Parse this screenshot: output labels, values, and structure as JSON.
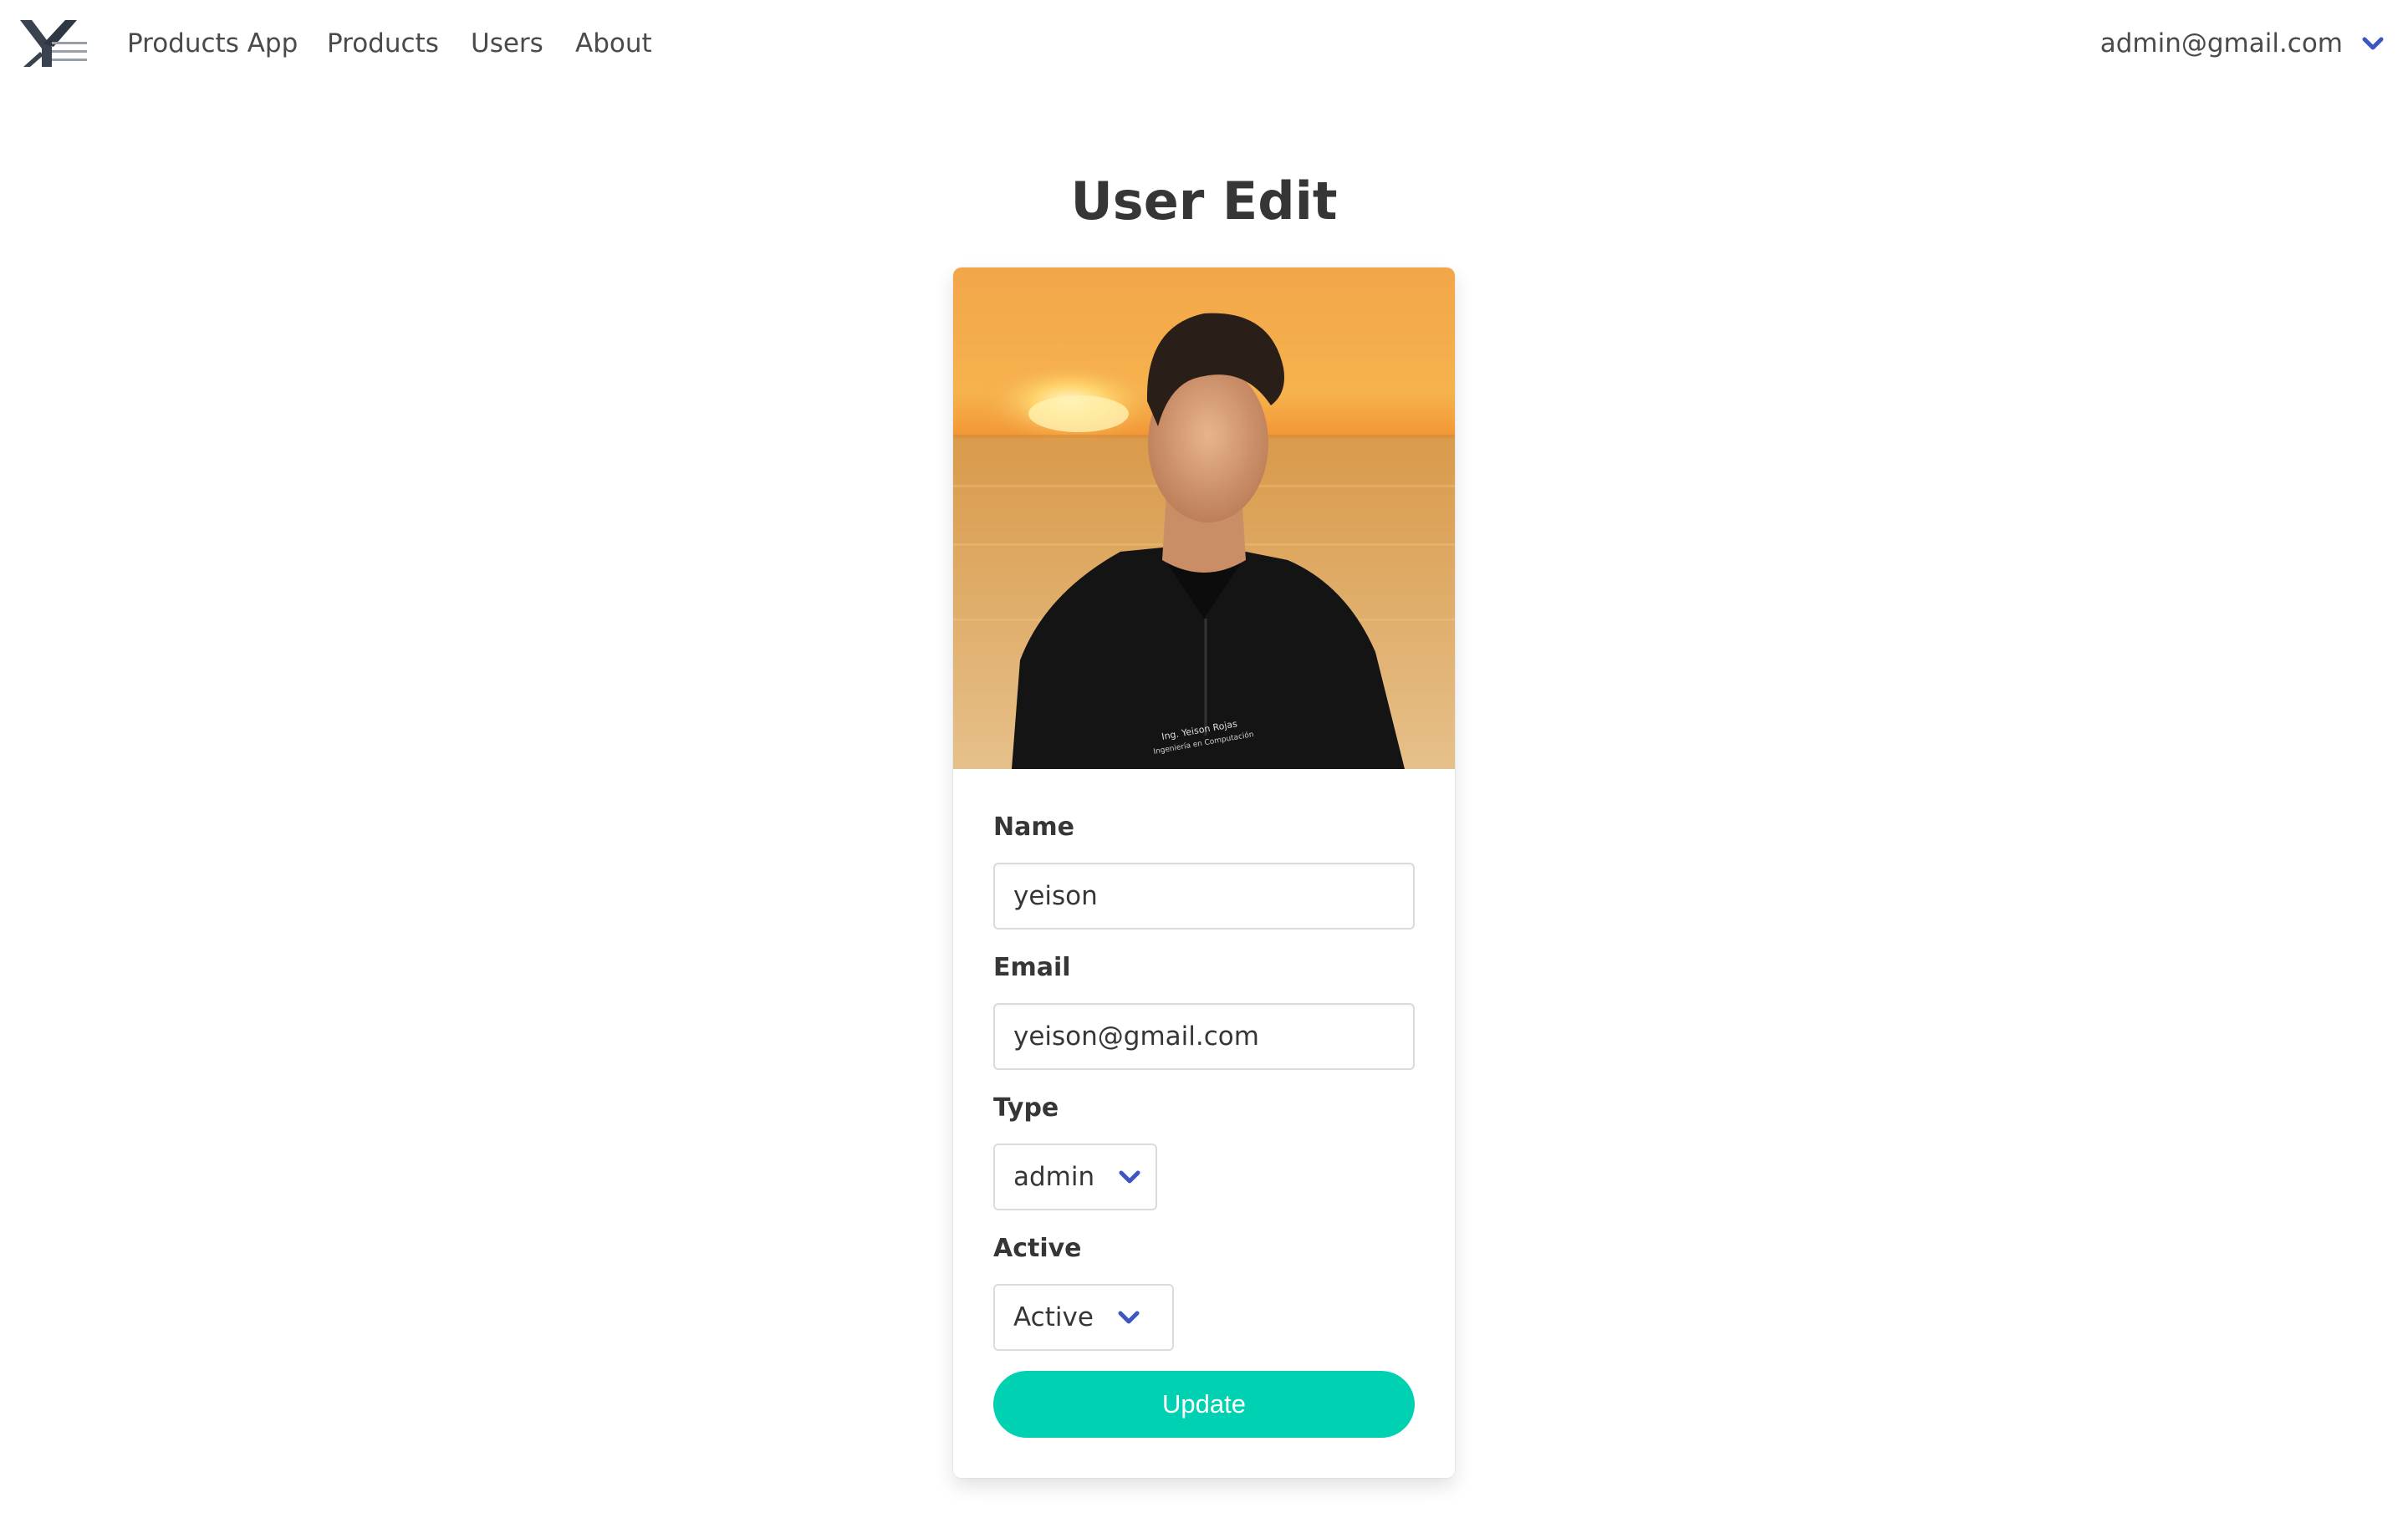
{
  "navbar": {
    "brand_icon": "yeison-logo-icon",
    "links": [
      {
        "label": "Products App"
      },
      {
        "label": "Products"
      },
      {
        "label": "Users"
      },
      {
        "label": "About"
      }
    ],
    "user_email": "admin@gmail.com",
    "user_menu_icon": "chevron-down-icon"
  },
  "page": {
    "title": "User Edit"
  },
  "card": {
    "photo_caption_line1": "Ing. Yeison Rojas",
    "photo_caption_line2": "Ingeniería en Computación",
    "name": {
      "label": "Name",
      "value": "yeison"
    },
    "email": {
      "label": "Email",
      "value": "yeison@gmail.com"
    },
    "type": {
      "label": "Type",
      "value": "admin"
    },
    "active": {
      "label": "Active",
      "value": "Active"
    },
    "update_label": "Update"
  },
  "colors": {
    "accent": "#00d1b2",
    "chevron": "#3e56c4",
    "text": "#363636"
  }
}
